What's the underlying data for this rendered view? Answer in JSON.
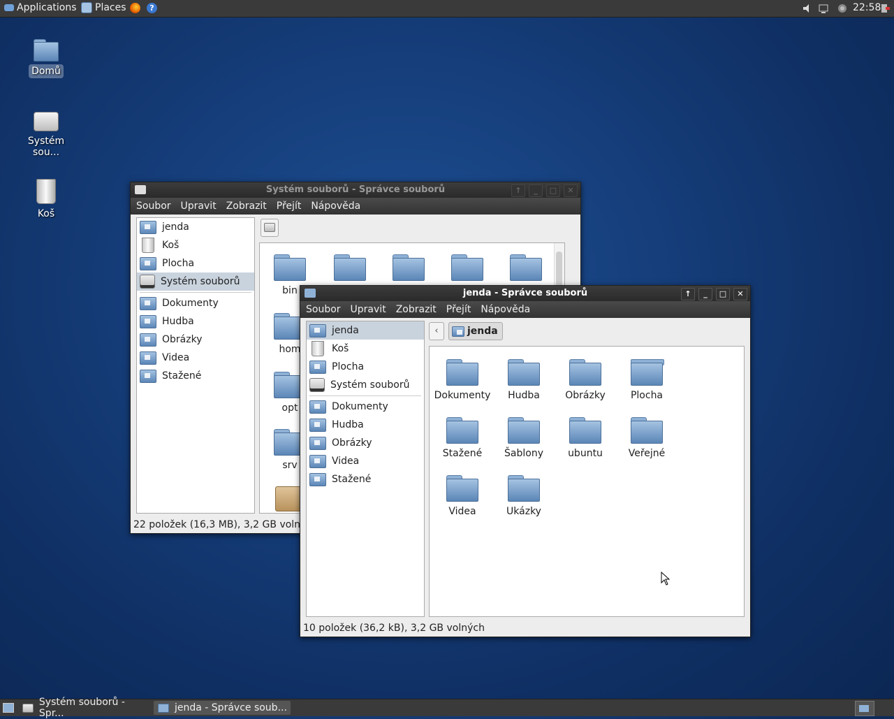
{
  "top_panel": {
    "applications": "Applications",
    "places": "Places",
    "clock": "22:58"
  },
  "desktop": {
    "icons": [
      {
        "label": "Domů"
      },
      {
        "label": "Systém sou..."
      },
      {
        "label": "Koš"
      }
    ]
  },
  "window_back": {
    "title": "Systém souborů - Správce souborů",
    "menu": [
      "Soubor",
      "Upravit",
      "Zobrazit",
      "Přejít",
      "Nápověda"
    ],
    "sidebar": [
      "jenda",
      "Koš",
      "Plocha",
      "Systém souborů",
      "Dokumenty",
      "Hudba",
      "Obrázky",
      "Videa",
      "Stažené"
    ],
    "files": [
      "bin",
      "hom",
      "opt",
      "srv"
    ],
    "status": "22 položek (16,3 MB), 3,2 GB volnýc"
  },
  "window_front": {
    "title": "jenda - Správce souborů",
    "menu": [
      "Soubor",
      "Upravit",
      "Zobrazit",
      "Přejít",
      "Nápověda"
    ],
    "sidebar": [
      "jenda",
      "Koš",
      "Plocha",
      "Systém souborů",
      "Dokumenty",
      "Hudba",
      "Obrázky",
      "Videa",
      "Stažené"
    ],
    "path_button": "jenda",
    "files": [
      "Dokumenty",
      "Hudba",
      "Obrázky",
      "Plocha",
      "Stažené",
      "Šablony",
      "ubuntu",
      "Veřejné",
      "Videa",
      "Ukázky"
    ],
    "status": "10 položek (36,2 kB), 3,2 GB volných"
  },
  "taskbar": {
    "tasks": [
      "Systém souborů - Spr...",
      "jenda - Správce soub..."
    ]
  }
}
